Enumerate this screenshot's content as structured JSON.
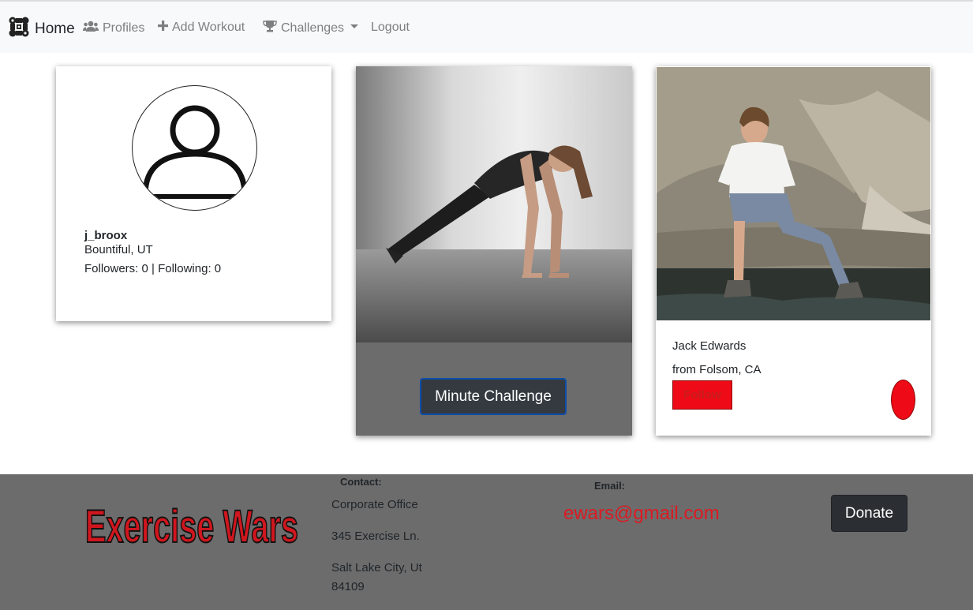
{
  "navbar": {
    "home_label": "Home",
    "logo_icon": "dumbbell-cross-icon",
    "items": [
      {
        "label": "Profiles",
        "icon": "users-icon"
      },
      {
        "label": "Add Workout",
        "icon": "plus-icon"
      },
      {
        "label": "Challenges",
        "icon": "trophy-icon"
      },
      {
        "label": "Logout"
      }
    ]
  },
  "user_card": {
    "username": "j_broox",
    "location": "Bountiful, UT",
    "follow_stats": "Followers: 0 | Following: 0",
    "avatar_icon": "user-outline-icon"
  },
  "challenge_card": {
    "button_label": "Minute Challenge"
  },
  "profile_card": {
    "name": "Jack Edwards",
    "from": "from Folsom, CA",
    "follow_label": "Follow"
  },
  "footer": {
    "logo_text": "Exercise Wars",
    "contact_title": "Contact:",
    "address_lines": [
      "Corporate Office",
      "345 Exercise Ln.",
      "Salt Lake City, Ut",
      "84109"
    ],
    "email_title": "Email:",
    "email": "ewars@gmail.com",
    "donate_label": "Donate"
  },
  "colors": {
    "navbar_bg": "#f8f9fa",
    "accent_red": "#ee0a16",
    "email_red": "#dc1a22",
    "footer_bg": "#6c6c6c",
    "dark_button": "#343a40"
  }
}
